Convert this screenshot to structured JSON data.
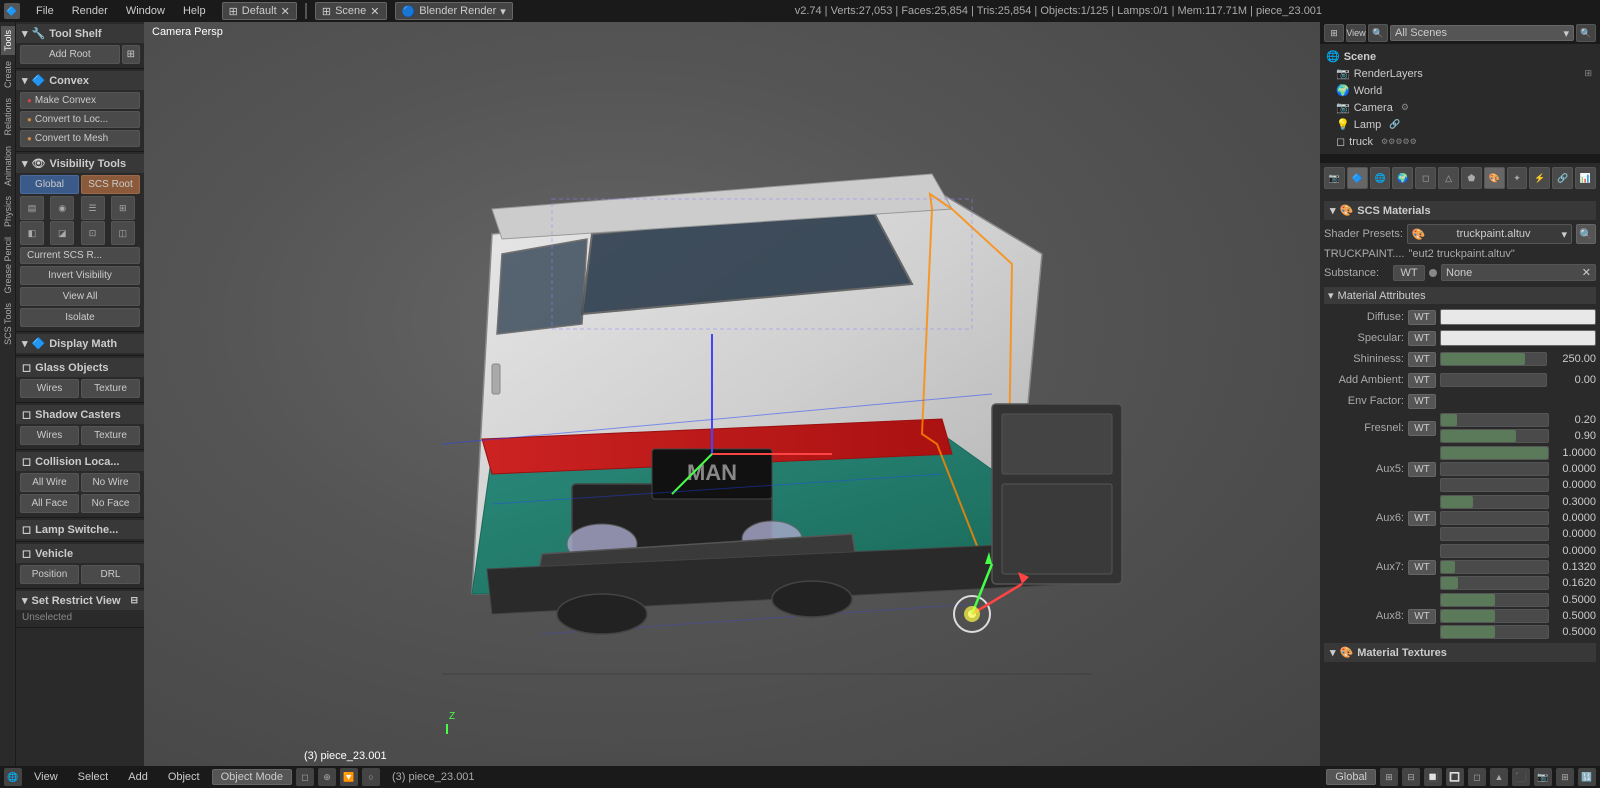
{
  "topbar": {
    "icon": "🔷",
    "menus": [
      "File",
      "Render",
      "Window",
      "Help"
    ],
    "layout_btn": "⊞",
    "layout_name": "Default",
    "close_btn": "✕",
    "view_icon": "⊞",
    "scene_label": "Scene",
    "render_engine": "Blender Render",
    "status": "v2.74 | Verts:27,053 | Faces:25,854 | Tris:25,854 | Objects:1/125 | Lamps:0/1 | Mem:117.71M | piece_23.001"
  },
  "left_panel": {
    "tool_shelf_label": "Tool Shelf",
    "add_root_btn": "Add Root",
    "convex_section": "Convex",
    "make_convex_btn": "Make Convex",
    "convert_to_loc_btn": "Convert to Loc...",
    "convert_to_mesh_btn": "Convert to Mesh",
    "visibility_section": "Visibility Tools",
    "global_btn": "Global",
    "scs_root_btn": "SCS Root",
    "current_scs_btn": "Current SCS R...",
    "invert_visibility_btn": "Invert Visibility",
    "view_all_btn": "View All",
    "isolate_btn": "Isolate",
    "display_math_section": "Display Math",
    "glass_objects_section": "Glass Objects",
    "wires_btn": "Wires",
    "texture_btn": "Texture",
    "shadow_casters_section": "Shadow Casters",
    "shadow_wires_btn": "Wires",
    "shadow_texture_btn": "Texture",
    "collision_section": "Collision Loca...",
    "all_wire_btn": "All Wire",
    "no_wire_btn": "No Wire",
    "all_face_btn": "All Face",
    "no_face_btn": "No Face",
    "lamp_switcher_section": "Lamp Switche...",
    "vehicle_section": "Vehicle",
    "position_btn": "Position",
    "drl_btn": "DRL",
    "set_restrict_section": "Set Restrict View",
    "unselected_label": "Unselected"
  },
  "viewport": {
    "camera_label": "Camera Persp"
  },
  "right_panel": {
    "view_btn": "View",
    "search_btn": "Search",
    "all_scenes": "All Scenes",
    "scene_section": "Scene",
    "render_layers": "RenderLayers",
    "world": "World",
    "camera": "Camera",
    "lamp": "Lamp",
    "truck": "truck"
  },
  "materials": {
    "section_title": "SCS Materials",
    "shader_presets_label": "Shader Presets:",
    "shader_value": "truckpaint.altuv",
    "truckpaint_label": "TRUCKPAINT....",
    "truckpaint_value": "\"eut2 truckpaint.altuv\"",
    "substance_label": "Substance:",
    "substance_wt": "WT",
    "substance_none": "None",
    "attr_section": "Material Attributes",
    "attrs": [
      {
        "label": "Diffuse:",
        "wt": "WT",
        "type": "colorbar"
      },
      {
        "label": "Specular:",
        "wt": "WT",
        "type": "colorbar"
      },
      {
        "label": "Shininess:",
        "wt": "WT",
        "type": "slider",
        "value": "250.00"
      },
      {
        "label": "Add Ambient:",
        "wt": "WT",
        "type": "slider",
        "value": "0.00"
      },
      {
        "label": "Env Factor:",
        "wt": "WT",
        "type": "empty"
      },
      {
        "label": "Fresnel:",
        "wt": "WT",
        "type": "dual_slider",
        "val1": "0.20",
        "val2": "0.90"
      },
      {
        "label": "Aux5:",
        "wt": "WT",
        "type": "triple_slider",
        "val1": "1.0000",
        "val2": "0.0000",
        "val3": "0.0000"
      },
      {
        "label": "Aux6:",
        "wt": "WT",
        "type": "triple_slider",
        "val1": "0.3000",
        "val2": "0.0000",
        "val3": "0.0000"
      },
      {
        "label": "Aux7:",
        "wt": "WT",
        "type": "triple_slider",
        "val1": "0.0000",
        "val2": "0.1320",
        "val3": "0.1620"
      },
      {
        "label": "Aux8:",
        "wt": "WT",
        "type": "triple_slider",
        "val1": "0.5000",
        "val2": "0.5000",
        "val3": "0.5000"
      }
    ],
    "textures_section": "Material Textures"
  },
  "bottombar": {
    "mode": "Object Mode",
    "info": "(3) piece_23.001",
    "global_label": "Global"
  }
}
